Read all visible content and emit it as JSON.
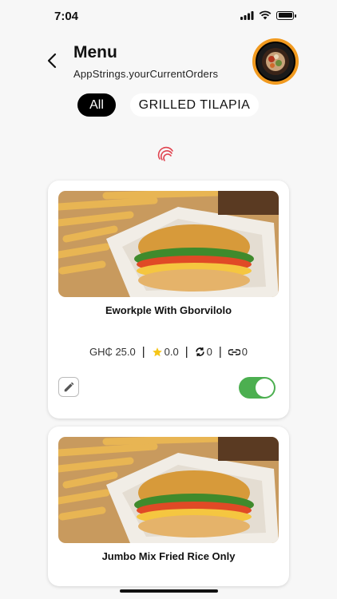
{
  "status_bar": {
    "time": "7:04",
    "icons": [
      "signal-icon",
      "wifi-icon",
      "battery-icon"
    ]
  },
  "header": {
    "back_icon": "chevron-left-icon",
    "title": "Menu",
    "subtitle": "AppStrings.yourCurrentOrders",
    "avatar": "restaurant-logo-avatar"
  },
  "filters": [
    {
      "label": "All",
      "selected": true
    },
    {
      "label": "GRILLED TILAPIA",
      "selected": false
    }
  ],
  "loading_indicator": "spinner-icon",
  "menu_items": [
    {
      "name": "Eworkple With Gborvilolo",
      "price": "GH₵ 25.0",
      "rating": "0.0",
      "reorders": "0",
      "shares": "0",
      "available": true
    },
    {
      "name": "Jumbo Mix Fried Rice Only"
    }
  ],
  "colors": {
    "accent": "#f19a1f",
    "chip_selected": "#000000",
    "toggle_on": "#4caf50",
    "star": "#f5c518"
  }
}
